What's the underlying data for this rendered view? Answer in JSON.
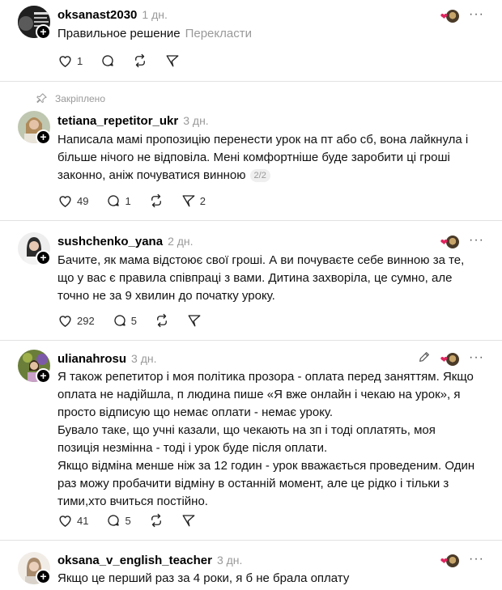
{
  "posts": [
    {
      "username": "oksanast2030",
      "time": "1 дн.",
      "text": "Правильное решение",
      "translate": "Перекласти",
      "likes": "1",
      "replies": "",
      "reposts": "",
      "shares": ""
    },
    {
      "pinned_label": "Закріплено",
      "username": "tetiana_repetitor_ukr",
      "time": "3 дн.",
      "text": "Написала мамі пропозицію перенести урок на пт або сб, вона лайкнула і більше нічого не відповіла. Мені комфортніше буде заробити ці гроші законно, аніж почуватися винною",
      "pager": "2/2",
      "likes": "49",
      "replies": "1",
      "reposts": "",
      "shares": "2"
    },
    {
      "username": "sushchenko_yana",
      "time": "2 дн.",
      "text": "Бачите, як мама відстоює свої гроші. А ви почуваєте себе винною за те, що у вас є правила співпраці з вами. Дитина захворіла, це сумно, але точно не за 9 хвилин до початку уроку.",
      "likes": "292",
      "replies": "5",
      "reposts": "",
      "shares": ""
    },
    {
      "username": "ulianahrosu",
      "time": "3 дн.",
      "text_lines": [
        "Я також репетитор і моя політика прозора - оплата перед заняттям. Якщо оплата не надійшла, п людина пише «Я вже онлайн і чекаю на урок», я просто відписую що немає оплати - немає уроку.",
        "Бувало таке, що учні казали, що чекають на зп і тоді оплатять, моя позиція незмінна - тоді і урок буде після оплати.",
        "Якщо відміна менше ніж за 12 годин - урок вважається проведеним. Один раз можу пробачити відміну в останній момент, але це рідко і тільки з тими,хто вчиться постійно."
      ],
      "likes": "41",
      "replies": "5",
      "reposts": "",
      "shares": ""
    },
    {
      "username": "oksana_v_english_teacher",
      "time": "3 дн.",
      "text": "Якщо це перший раз за 4 роки, я б не брала оплату"
    }
  ],
  "colors": {
    "heart": "#e0245e",
    "muted": "#999999",
    "divider": "#e2e2e2"
  },
  "icons": {
    "like": "heart-icon",
    "reply": "comment-icon",
    "repost": "repost-icon",
    "share": "send-icon",
    "pin": "pin-icon",
    "more": "more-icon",
    "edit": "pencil-icon"
  }
}
